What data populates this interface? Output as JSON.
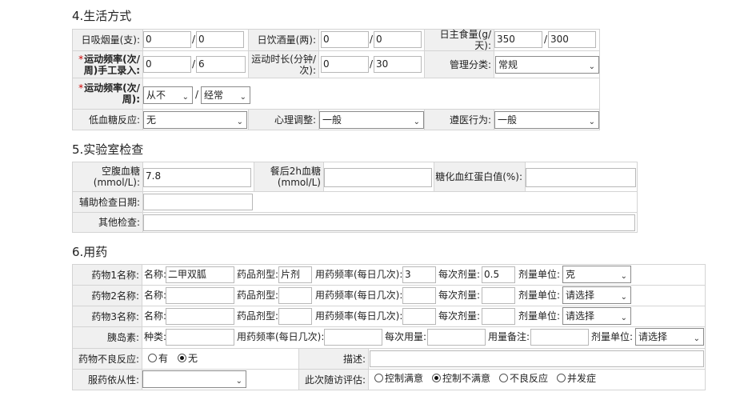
{
  "lifestyle": {
    "title": "4.生活方式",
    "smoke_label": "日吸烟量(支):",
    "smoke_current": "0",
    "smoke_target": "0",
    "drink_label": "日饮酒量(两):",
    "drink_current": "0",
    "drink_target": "0",
    "staple_label": "日主食量(g/天):",
    "staple_current": "350",
    "staple_target": "300",
    "exercise_manual_label": "运动频率(次/周)手工录入:",
    "exercise_manual_current": "0",
    "exercise_manual_target": "6",
    "exercise_duration_label": "运动时长(分钟/次):",
    "exercise_duration_current": "0",
    "exercise_duration_target": "30",
    "mgmt_label": "管理分类:",
    "mgmt_value": "常规",
    "exercise_freq_label": "运动频率(次/周):",
    "exercise_freq_current": "从不",
    "exercise_freq_target": "经常",
    "hypo_label": "低血糖反应:",
    "hypo_value": "无",
    "psych_label": "心理调整:",
    "psych_value": "一般",
    "compliance_label": "遵医行为:",
    "compliance_value": "一般",
    "slash": "/"
  },
  "lab": {
    "title": "5.实验室检查",
    "fbg_label_1": "空腹血糖",
    "fbg_label_2": "(mmol/L):",
    "fbg_value": "7.8",
    "pbg_label_1": "餐后2h血糖",
    "pbg_label_2": "(mmol/L)",
    "pbg_value": "",
    "hba1c_label": "糖化血红蛋白值(%):",
    "hba1c_value": "",
    "aux_date_label": "辅助检查日期:",
    "aux_date_value": "",
    "other_label": "其他检查:",
    "other_value": ""
  },
  "meds": {
    "title": "6.用药",
    "name_label": "名称:",
    "form_label": "药品剂型:",
    "freq_label": "用药频率(每日几次):",
    "dose_label": "每次剂量:",
    "unit_label": "剂量单位:",
    "rows": [
      {
        "label": "药物1名称:",
        "name": "二甲双胍",
        "form": "片剂",
        "freq": "3",
        "dose": "0.5",
        "unit": "克"
      },
      {
        "label": "药物2名称:",
        "name": "",
        "form": "",
        "freq": "",
        "dose": "",
        "unit": "请选择"
      },
      {
        "label": "药物3名称:",
        "name": "",
        "form": "",
        "freq": "",
        "dose": "",
        "unit": "请选择"
      }
    ],
    "insulin_label": "胰岛素:",
    "insulin_type_label": "种类:",
    "insulin_freq_label": "用药频率(每日几次):",
    "insulin_dose_label": "每次用量:",
    "insulin_note_label": "用量备注:",
    "insulin_unit_label": "剂量单位:",
    "insulin_unit_value": "请选择",
    "adverse_label": "药物不良反应:",
    "adverse_yes": "有",
    "adverse_no": "无",
    "desc_label": "描述:",
    "adherence_label": "服药依从性:",
    "adherence_value": "",
    "eval_label": "此次随访评估:",
    "eval_options": [
      "控制满意",
      "控制不满意",
      "不良反应",
      "并发症"
    ]
  }
}
